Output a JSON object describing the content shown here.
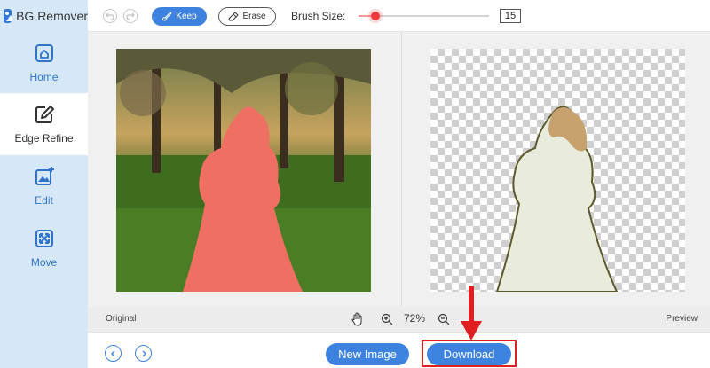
{
  "app": {
    "title": "BG Remover"
  },
  "sidebar": {
    "items": [
      {
        "label": "Home",
        "icon": "home-icon",
        "active": false
      },
      {
        "label": "Edge Refine",
        "icon": "edit-pen-icon",
        "active": true
      },
      {
        "label": "Edit",
        "icon": "image-edit-icon",
        "active": false
      },
      {
        "label": "Move",
        "icon": "move-arrows-icon",
        "active": false
      }
    ]
  },
  "toolbar": {
    "keep_label": "Keep",
    "erase_label": "Erase",
    "brush_size_label": "Brush Size:",
    "brush_size_value": "15",
    "brush_slider_fraction": 0.13
  },
  "statusbar": {
    "original_label": "Original",
    "zoom_value": "72%",
    "preview_label": "Preview"
  },
  "bottombar": {
    "new_image_label": "New Image",
    "download_label": "Download"
  },
  "colors": {
    "accent": "#3e82e0",
    "sidebar_bg": "#d6e8f8",
    "highlight_red": "#e02020",
    "mask_red": "#ef6f62"
  }
}
